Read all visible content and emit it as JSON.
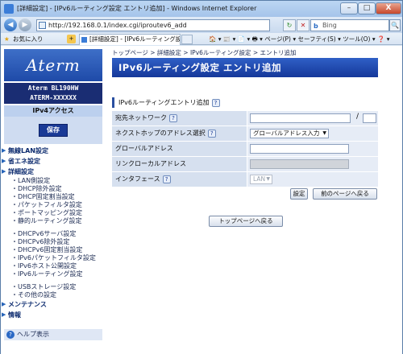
{
  "window": {
    "title": "[詳細設定] - [IPv6ルーティング設定 エントリ追加] - Windows Internet Explorer",
    "min": "–",
    "max": "□",
    "close": "X"
  },
  "address": {
    "url": "http://192.168.0.1/index.cgi/iproutev6_add",
    "search_placeholder": "Bing",
    "search_icon": "magnifier-icon",
    "back": "◀",
    "forward": "▶",
    "refresh": "↻",
    "stop": "✕",
    "search_btn": "🔍"
  },
  "favorites": {
    "label": "お気に入り",
    "tab_title": "[詳細設定] - [IPv6ルーティング設定...",
    "commands": "🏠 ▾ 📰 ▾ 📄 ▾ 🖶 ▾  ページ(P) ▾  セーフティ(S) ▾  ツール(O) ▾  ❓ ▾"
  },
  "sidebar": {
    "logo": "Aterm",
    "model_line1": "Aterm BL190HW",
    "model_line2": "ATERM-XXXXXX",
    "ipv4": "IPv4アクセス",
    "save": "保存",
    "sections": [
      {
        "label": "無線LAN設定",
        "items": []
      },
      {
        "label": "省エネ設定",
        "items": []
      },
      {
        "label": "詳細設定",
        "items": [
          "・LAN側設定",
          "・DHCP除外設定",
          "・DHCP固定割当設定",
          "・パケットフィルタ設定",
          "・ポートマッピング設定",
          "・静的ルーティング設定",
          "",
          "・DHCPv6サーバ設定",
          "・DHCPv6除外設定",
          "・DHCPv6固定割当設定",
          "・IPv6パケットフィルタ設定",
          "・IPv6ホスト公開設定",
          "・IPv6ルーティング設定",
          "",
          "・USBストレージ設定",
          "・その他の設定"
        ]
      },
      {
        "label": "メンテナンス",
        "items": []
      },
      {
        "label": "情報",
        "items": []
      }
    ],
    "help": "ヘルプ表示"
  },
  "main": {
    "breadcrumb": "トップページ > 詳細設定 > IPv6ルーティング設定 > エントリ追加",
    "title": "IPv6ルーティング設定 エントリ追加",
    "section_title": "IPv6ルーティングエントリ追加",
    "help_mark": "?",
    "rows": [
      {
        "label": "宛先ネットワーク",
        "value": "",
        "prefix": ""
      },
      {
        "label": "ネクストホップのアドレス選択",
        "value": "グローバルアドレス入力"
      },
      {
        "label": "グローバルアドレス",
        "value": ""
      },
      {
        "label": "リンクローカルアドレス",
        "value": ""
      },
      {
        "label": "インタフェース",
        "value": "LAN"
      }
    ],
    "slash": "/",
    "set_button": "設定",
    "prev_button": "前のページへ戻る",
    "top_button": "トップページへ戻る"
  }
}
